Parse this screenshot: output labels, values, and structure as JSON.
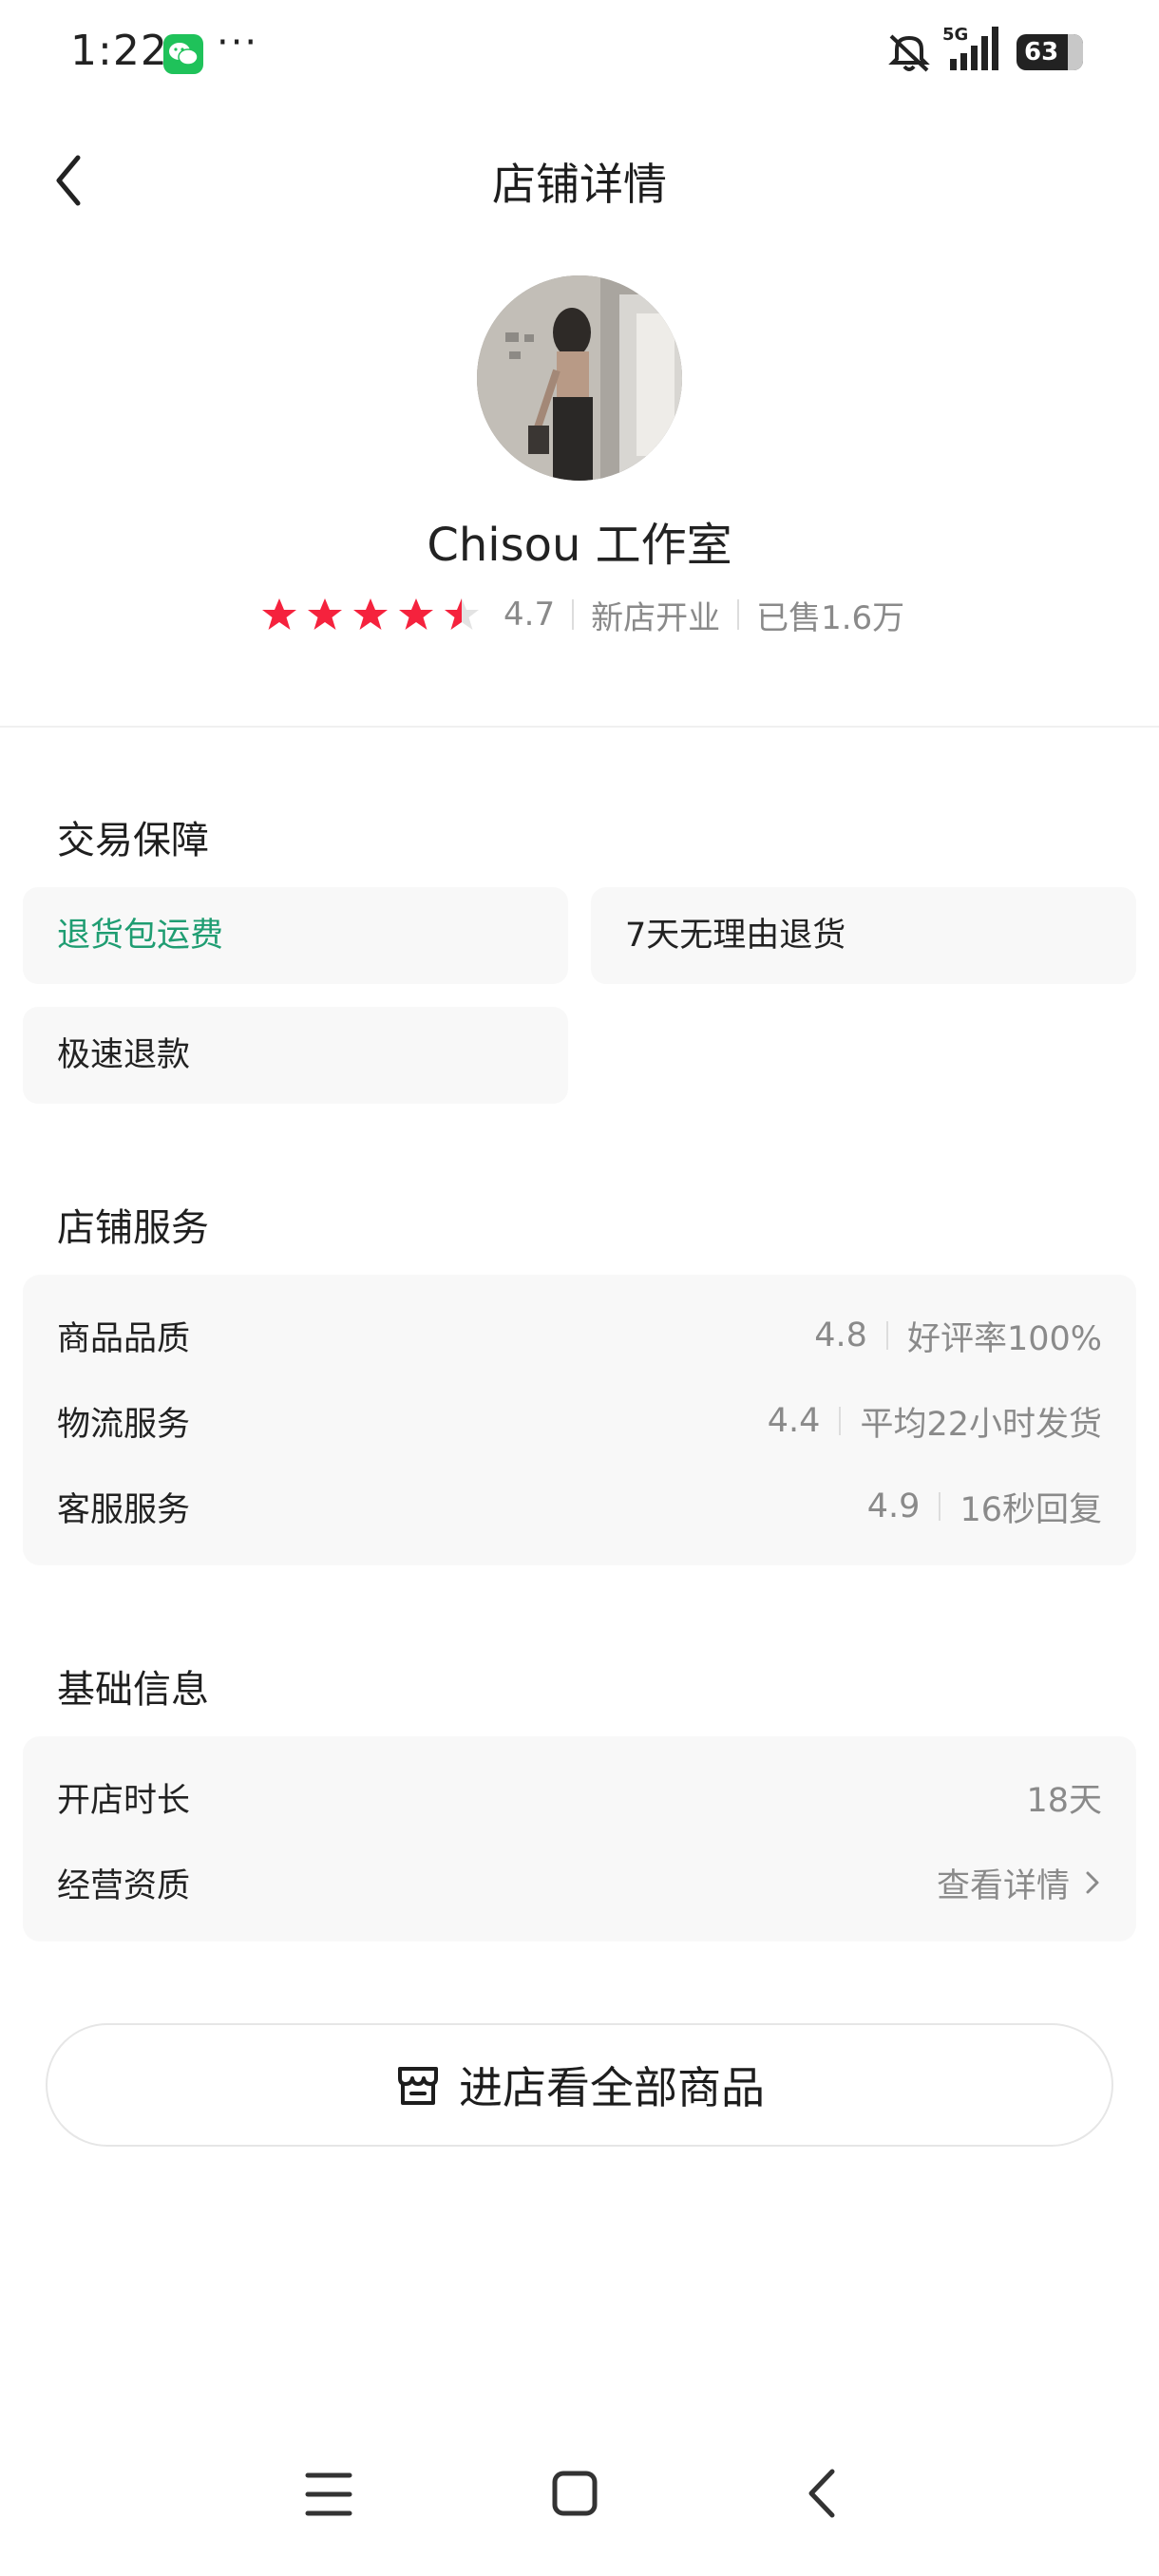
{
  "status_bar": {
    "time": "1:22",
    "dots": "···",
    "network": "5G",
    "battery": "63"
  },
  "header": {
    "title": "店铺详情"
  },
  "shop": {
    "name": "Chisou 工作室",
    "rating_value": "4.7",
    "rating_stars": 4.5,
    "badge": "新店开业",
    "sold": "已售1.6万"
  },
  "guarantee": {
    "title": "交易保障",
    "tags": [
      "退货包运费",
      "7天无理由退货",
      "极速退款"
    ]
  },
  "service": {
    "title": "店铺服务",
    "rows": [
      {
        "label": "商品品质",
        "score": "4.8",
        "detail": "好评率100%"
      },
      {
        "label": "物流服务",
        "score": "4.4",
        "detail": "平均22小时发货"
      },
      {
        "label": "客服服务",
        "score": "4.9",
        "detail": "16秒回复"
      }
    ]
  },
  "basic": {
    "title": "基础信息",
    "rows": [
      {
        "label": "开店时长",
        "value": "18天"
      },
      {
        "label": "经营资质",
        "value": "查看详情"
      }
    ]
  },
  "cta": {
    "label": "进店看全部商品"
  },
  "colors": {
    "star": "#f5223d",
    "accent_green": "#1f9d72"
  }
}
